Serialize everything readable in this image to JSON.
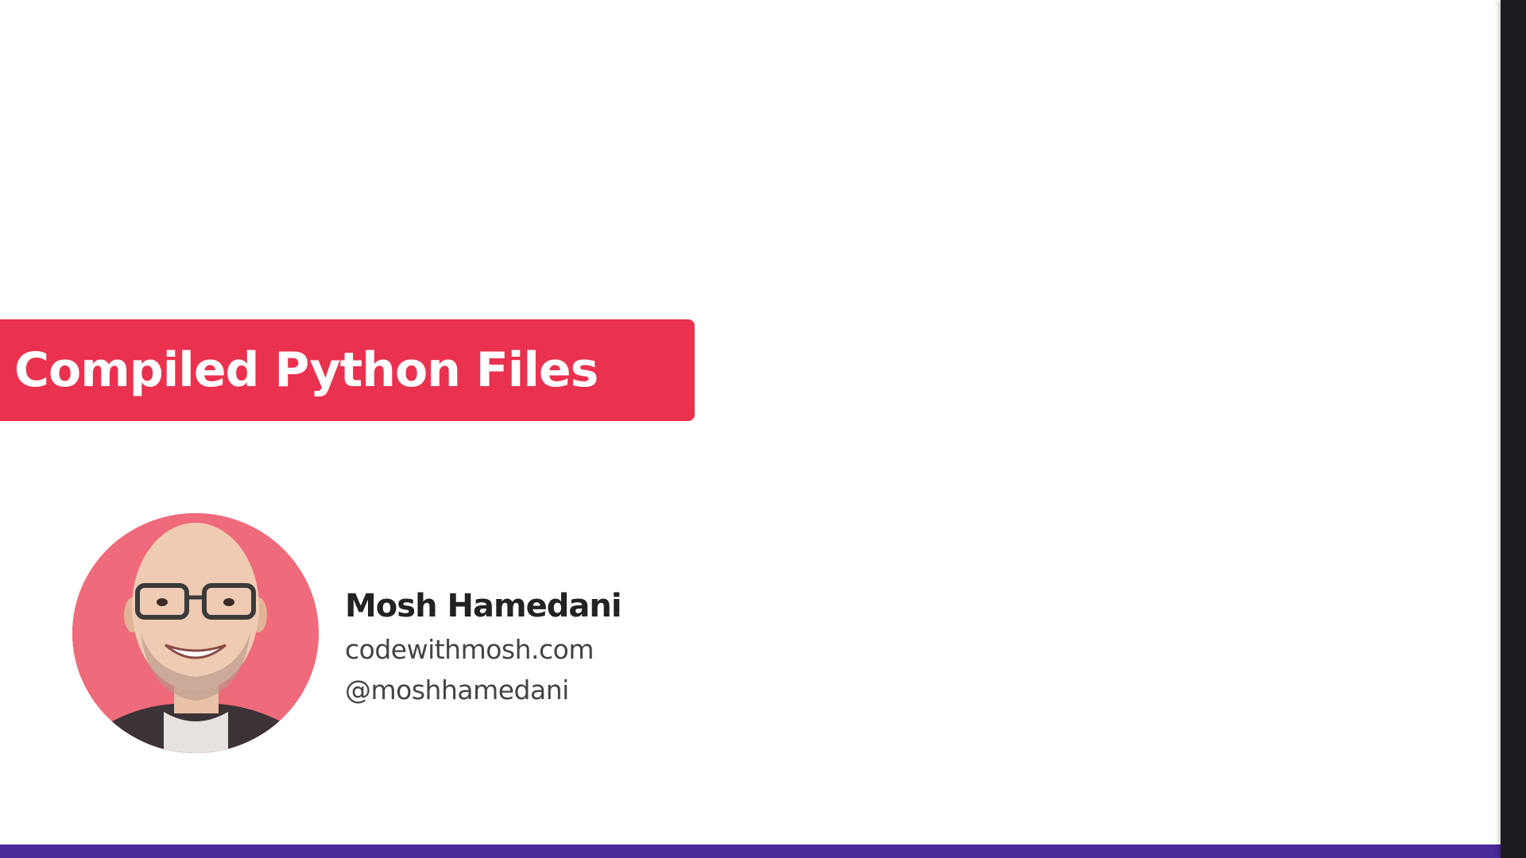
{
  "slide": {
    "title": "Compiled Python Files",
    "author": {
      "name": "Mosh Hamedani",
      "website": "codewithmosh.com",
      "handle": "@moshhamedani",
      "avatar_icon": "presenter-portrait"
    }
  },
  "colors": {
    "banner": "#ea314f",
    "bottom_bar": "#4b2a9a",
    "background": "#ffffff",
    "right_edge": "#1e1c22"
  }
}
